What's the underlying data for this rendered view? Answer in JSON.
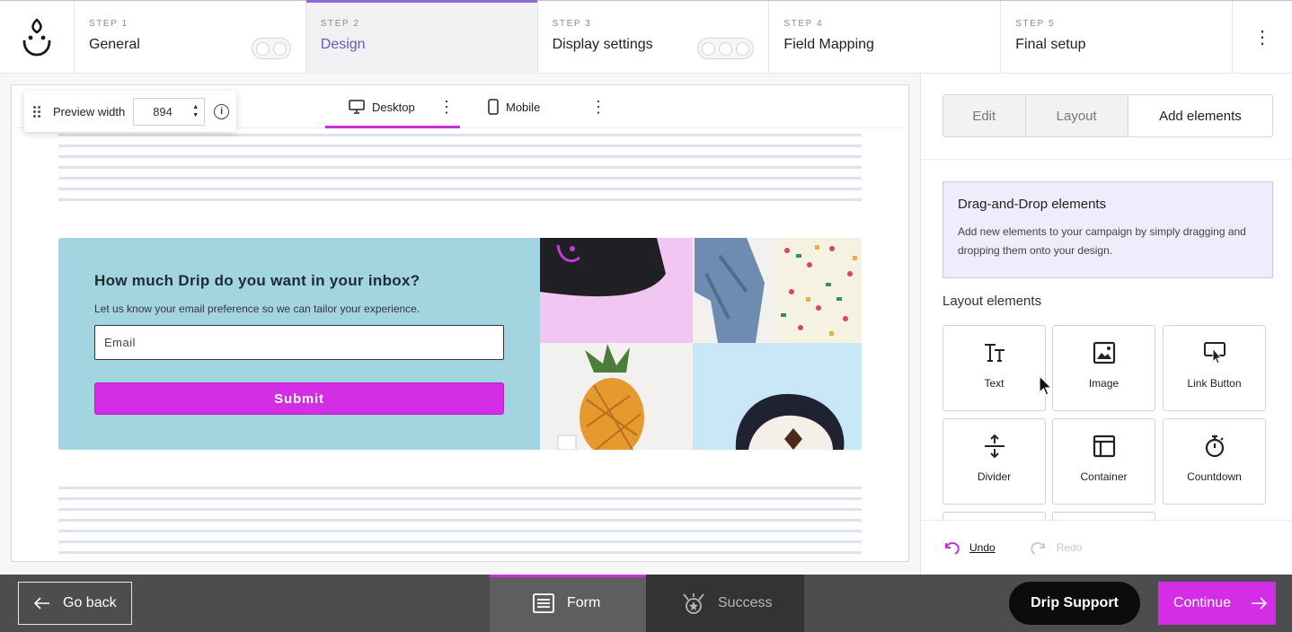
{
  "steps": [
    {
      "num": "STEP 1",
      "title": "General"
    },
    {
      "num": "STEP 2",
      "title": "Design"
    },
    {
      "num": "STEP 3",
      "title": "Display settings"
    },
    {
      "num": "STEP 4",
      "title": "Field Mapping"
    },
    {
      "num": "STEP 5",
      "title": "Final setup"
    }
  ],
  "topbar": {
    "menu_icon": "kebab-icon"
  },
  "canvas": {
    "preview_width_label": "Preview width",
    "preview_width_value": "894",
    "devices": [
      {
        "label": "Desktop",
        "icon": "monitor-icon"
      },
      {
        "label": "Mobile",
        "icon": "phone-icon"
      }
    ]
  },
  "form": {
    "title": "How much Drip do you want in your inbox?",
    "subtitle": "Let us know your email preference so we can tailor your experience.",
    "email_placeholder": "Email",
    "submit_label": "Submit"
  },
  "panel": {
    "tabs": [
      "Edit",
      "Layout",
      "Add elements"
    ],
    "dnd_title": "Drag-and-Drop elements",
    "dnd_text": "Add new elements to your campaign by simply dragging and dropping them onto your design.",
    "layout_title": "Layout elements",
    "tiles": [
      {
        "label": "Text",
        "icon": "text-icon"
      },
      {
        "label": "Image",
        "icon": "image-icon"
      },
      {
        "label": "Link Button",
        "icon": "link-button-icon"
      },
      {
        "label": "Divider",
        "icon": "divider-icon"
      },
      {
        "label": "Container",
        "icon": "container-icon"
      },
      {
        "label": "Countdown",
        "icon": "countdown-icon"
      }
    ],
    "undo_label": "Undo",
    "redo_label": "Redo"
  },
  "bottom": {
    "go_back": "Go back",
    "tabs": [
      {
        "label": "Form",
        "icon": "form-icon"
      },
      {
        "label": "Success",
        "icon": "success-icon"
      }
    ],
    "support": "Drip Support",
    "continue": "Continue"
  },
  "colors": {
    "accent": "#d42de6",
    "active_step": "#8b6ad8",
    "form_bg": "#a3d5e0"
  }
}
